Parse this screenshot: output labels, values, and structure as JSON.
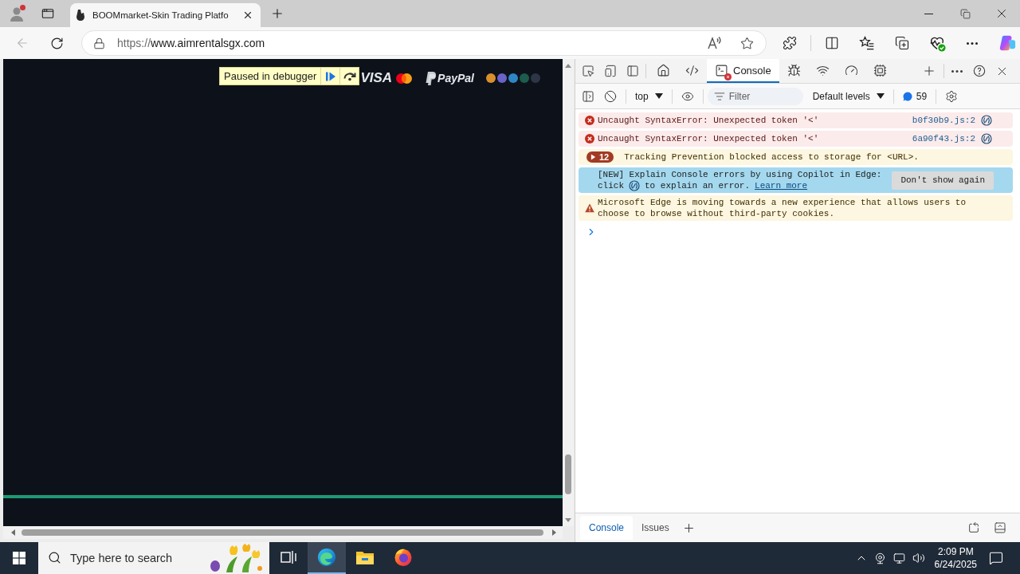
{
  "browser": {
    "tab": {
      "title": "BOOMmarket-Skin Trading Platfo"
    },
    "back_enabled": false,
    "url": {
      "scheme": "https://",
      "host": "www.aimrentalsgx.com"
    }
  },
  "page": {
    "debugger": {
      "label": "Paused in debugger"
    },
    "visa": "VISA",
    "paypal": "PayPal",
    "coins": [
      {
        "color": "#d8902c"
      },
      {
        "color": "#6a62c8"
      },
      {
        "color": "#2e86c6"
      },
      {
        "color": "#1d5c4c"
      },
      {
        "color": "#2f3548"
      }
    ]
  },
  "devtools": {
    "tabs": [
      {
        "kind": "welcome",
        "selected": false,
        "error_badge": false
      },
      {
        "kind": "elements",
        "selected": false,
        "error_badge": false
      },
      {
        "kind": "console",
        "label": "Console",
        "selected": true,
        "error_badge": true
      },
      {
        "kind": "sources",
        "selected": false,
        "error_badge": false
      },
      {
        "kind": "network",
        "selected": false,
        "error_badge": false
      },
      {
        "kind": "performance",
        "selected": false,
        "error_badge": false
      },
      {
        "kind": "memory",
        "selected": false,
        "error_badge": false
      }
    ],
    "console_toolbar": {
      "context": "top",
      "filter_placeholder": "Filter",
      "levels": "Default levels",
      "message_count": "59"
    },
    "messages": [
      {
        "kind": "error",
        "text": "Uncaught SyntaxError: Unexpected token '<'",
        "source": "b0f30b9.js:2"
      },
      {
        "kind": "error",
        "text": "Uncaught SyntaxError: Unexpected token '<'",
        "source": "6a90f43.js:2"
      },
      {
        "kind": "group",
        "count": "12",
        "expanded": false,
        "text": "Tracking Prevention blocked access to storage for <URL>."
      },
      {
        "kind": "notice",
        "text": "[NEW] Explain Console errors by using Copilot in Edge:",
        "text_2": "click",
        "text_3": "to explain an error.",
        "link": "Learn more",
        "button": "Don't show again"
      },
      {
        "kind": "warning",
        "text": "Microsoft Edge is moving towards a new experience that allows users to choose to browse without third-party cookies."
      }
    ],
    "drawer_tabs": [
      {
        "label": "Console",
        "selected": true
      },
      {
        "label": "Issues",
        "selected": false
      }
    ]
  },
  "taskbar": {
    "search_placeholder": "Type here to search",
    "apps": [
      {
        "kind": "task_view",
        "selected": false
      },
      {
        "kind": "edge",
        "selected": true
      },
      {
        "kind": "explorer",
        "selected": false
      },
      {
        "kind": "firefox",
        "selected": false
      }
    ],
    "time": "2:09 PM",
    "date": "6/24/2025"
  }
}
